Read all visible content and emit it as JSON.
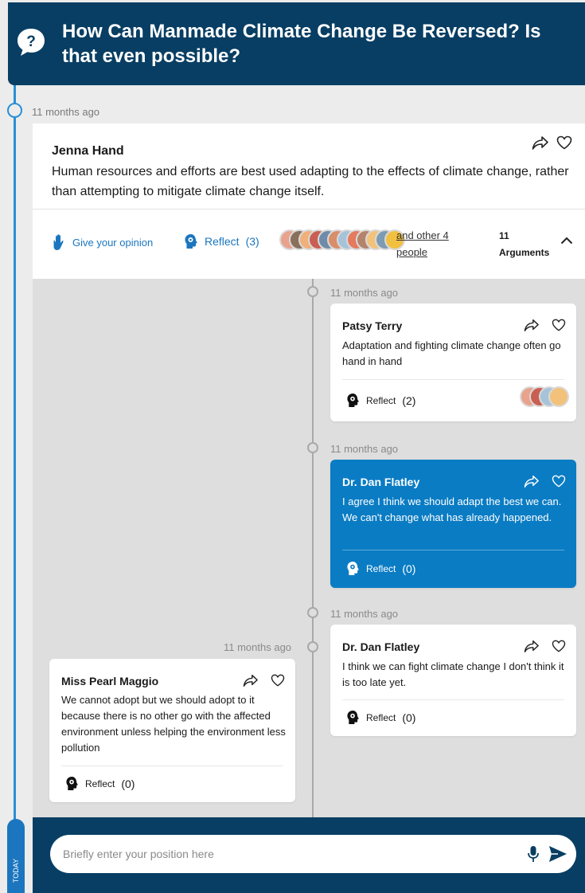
{
  "header": {
    "title": "How Can Manmade Climate Change Be Reversed? Is that even possible?",
    "icon": "question-bubble-icon"
  },
  "timeline": {
    "today_label": "TODAY"
  },
  "main_post": {
    "time": "11 months ago",
    "author": "Jenna Hand",
    "text": "Human resources and efforts are best used adapting to the effects of climate change, rather than attempting to mitigate climate change itself.",
    "give_opinion_label": "Give your opinion",
    "reflect_label": "Reflect",
    "reflect_count": "(3)",
    "others_text": "and other 4 people",
    "arguments_count": "11",
    "arguments_label": "Arguments"
  },
  "replies": [
    {
      "time": "11 months ago",
      "author": "Patsy Terry",
      "text": "Adaptation and fighting climate change often go hand in hand",
      "reflect_label": "Reflect",
      "reflect_count": "(2)"
    },
    {
      "time": "11 months ago",
      "author": "Dr. Dan Flatley",
      "text": "I agree I think we should adapt the best we can. We can't change what has already happened.",
      "reflect_label": "Reflect",
      "reflect_count": "(0)"
    },
    {
      "time": "11 months ago",
      "author": "Dr. Dan Flatley",
      "text": "I think we can fight climate change I don't think it is too late yet.",
      "reflect_label": "Reflect",
      "reflect_count": "(0)"
    },
    {
      "time": "11 months ago",
      "author": "Miss Pearl Maggio",
      "text": "We cannot adopt but we should adopt to it because there is no other go with the affected environment unless helping the environment less pollution",
      "reflect_label": "Reflect",
      "reflect_count": "(0)"
    }
  ],
  "input": {
    "placeholder": "Briefly enter your position here"
  },
  "colors": {
    "header_bg": "#083e63",
    "accent": "#1b76bf",
    "highlight_card": "#0a7cc4",
    "timeline": "#2a8fd6"
  }
}
